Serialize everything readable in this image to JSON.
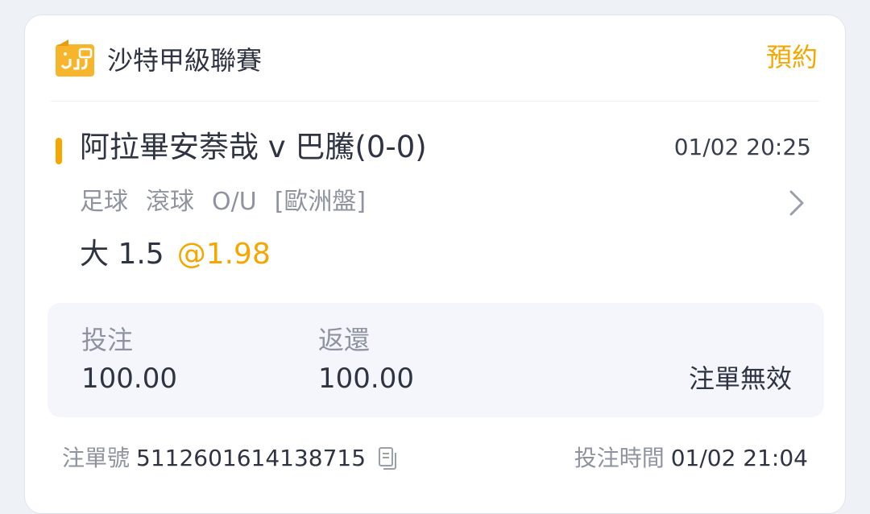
{
  "header": {
    "league_name": "沙特甲級聯賽",
    "status_link": "預約"
  },
  "match": {
    "title": "阿拉畢安萘哉 v 巴騰(0-0)",
    "time": "01/02 20:25",
    "sport": "足球",
    "mode": "滾球",
    "market": "O/U",
    "handicap_type": "[歐洲盤]",
    "pick": "大 1.5",
    "at_symbol": "@",
    "odds": "1.98"
  },
  "summary": {
    "stake_label": "投注",
    "stake_value": "100.00",
    "return_label": "返還",
    "return_value": "100.00",
    "status": "注單無效"
  },
  "footer": {
    "bet_id_label": "注單號",
    "bet_id": "5112601614138715",
    "bet_time_label": "投注時間",
    "bet_time": "01/02 21:04"
  },
  "icons": {
    "league_logo": "league-logo-icon",
    "chevron": "chevron-right-icon",
    "copy": "copy-icon"
  },
  "colors": {
    "accent": "#f5a700",
    "text_primary": "#2f3442",
    "text_secondary": "#8e939f",
    "summary_bg": "#f4f6fb"
  }
}
